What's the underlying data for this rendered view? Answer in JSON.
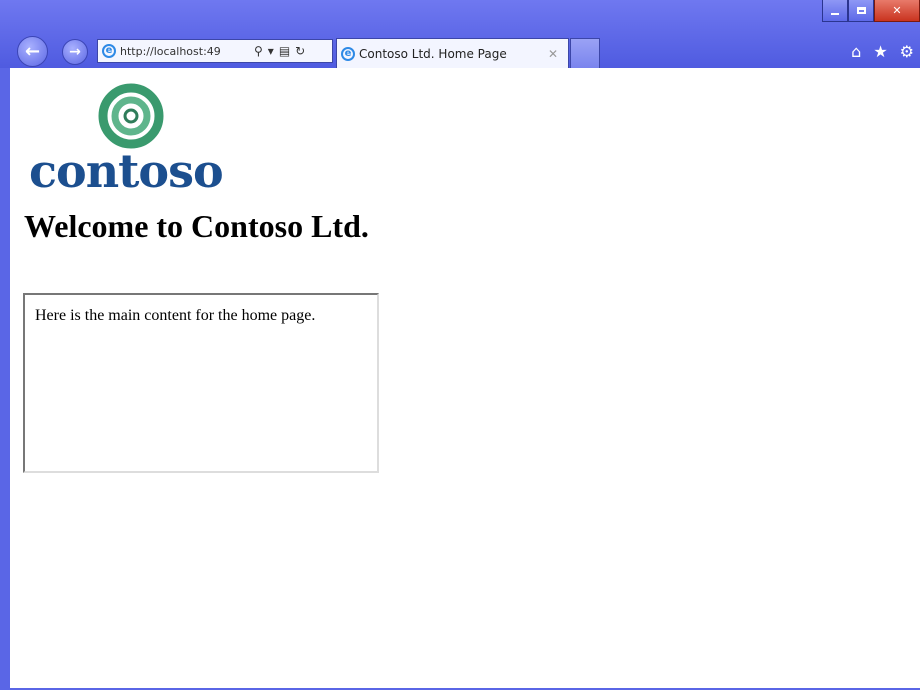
{
  "browser": {
    "address": "http://localhost:49",
    "tab_title": "Contoso Ltd. Home Page"
  },
  "page": {
    "logo_text": "contoso",
    "heading": "Welcome to Contoso Ltd.",
    "main_content": "Here is the main content for the home page."
  },
  "colors": {
    "frame": "#5a66e6",
    "logo_green": "#3a9a6e",
    "logo_blue": "#1c4f8f"
  }
}
